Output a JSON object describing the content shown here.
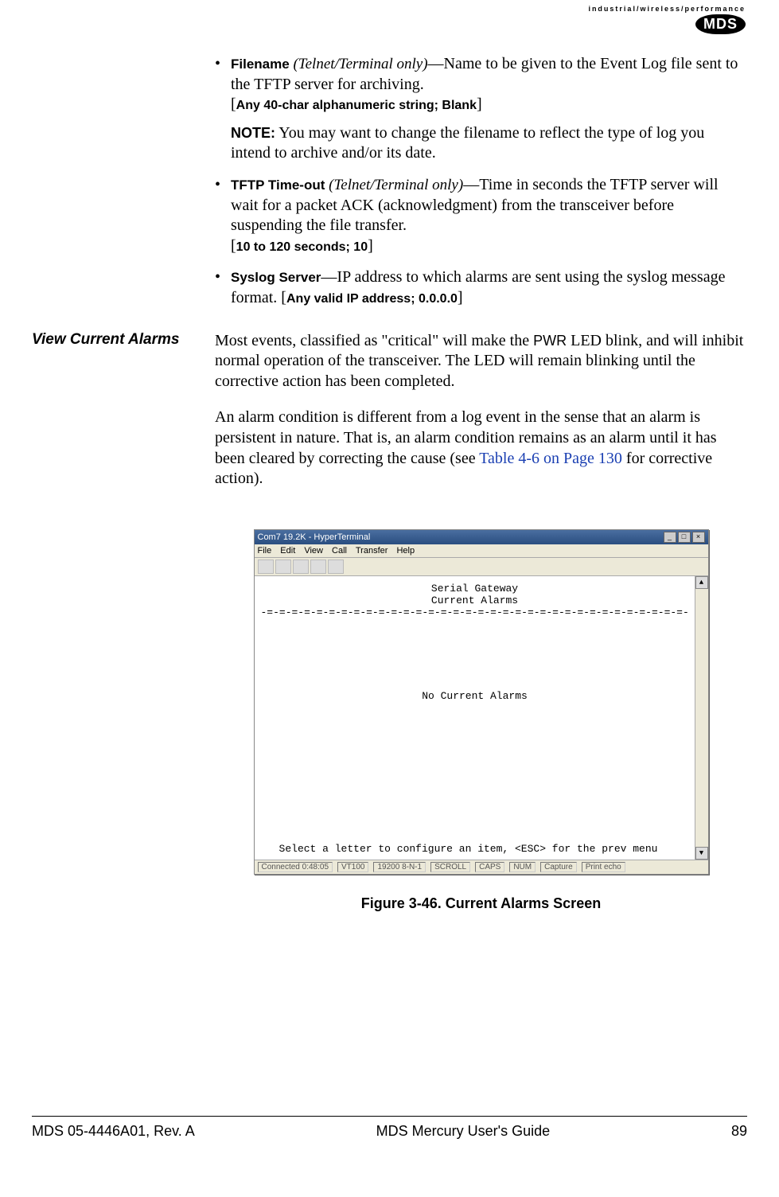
{
  "logo": {
    "tagline": "industrial/wireless/performance",
    "badge": "MDS"
  },
  "bullets": [
    {
      "term": "Filename",
      "qualifier": " (Telnet/Terminal only)",
      "desc": "—Name to be given to the Event Log file sent to the TFTP server for archiving.",
      "constraint": "Any 40-char alphanumeric string; Blank",
      "note_label": "NOTE:",
      "note_text": " You may want to change the filename to reflect the type of log you intend to archive and/or its date."
    },
    {
      "term": "TFTP Time-out",
      "qualifier": "  (Telnet/Terminal only)",
      "desc": "—Time in seconds the TFTP server will wait for a packet ACK (acknowledgment) from the transceiver before suspending the file transfer.",
      "constraint": "10 to 120 seconds; 10"
    },
    {
      "term": "Syslog Server",
      "qualifier": "",
      "desc": "—IP address to which alarms are sent using the syslog message format. [",
      "constraint_inline": "Any valid IP address; 0.0.0.0",
      "desc_tail": "]"
    }
  ],
  "section": {
    "sidehead": "View Current Alarms",
    "para1_a": "Most events, classified as \"critical\" will make the ",
    "para1_pwr": "PWR",
    "para1_b": " LED blink, and will inhibit normal operation of the transceiver. The LED will remain blinking until the corrective action has been completed.",
    "para2_a": "An alarm condition is different from a log event in the sense that an alarm is persistent in nature. That is, an alarm condition remains as an alarm until it has been cleared by correcting the cause (see ",
    "para2_link": "Table 4-6 on Page 130",
    "para2_b": " for corrective action)."
  },
  "terminal": {
    "title": "Com7 19.2K - HyperTerminal",
    "menu": [
      "File",
      "Edit",
      "View",
      "Call",
      "Transfer",
      "Help"
    ],
    "body_title": "Serial Gateway\nCurrent Alarms",
    "rule": "-=-=-=-=-=-=-=-=-=-=-=-=-=-=-=-=-=-=-=-=-=-=-=-=-=-=-=-=-=-=-=-=-=-=-=-=-",
    "message": "No Current Alarms",
    "footer_hint": "Select a letter to configure an item, <ESC> for the prev menu",
    "status": [
      "Connected 0:48:05",
      "VT100",
      "19200 8-N-1",
      "SCROLL",
      "CAPS",
      "NUM",
      "Capture",
      "Print echo"
    ]
  },
  "figure_caption": "Figure 3-46. Current Alarms Screen",
  "footer": {
    "left": "MDS 05-4446A01, Rev. A",
    "center": "MDS Mercury User's Guide",
    "right": "89"
  }
}
